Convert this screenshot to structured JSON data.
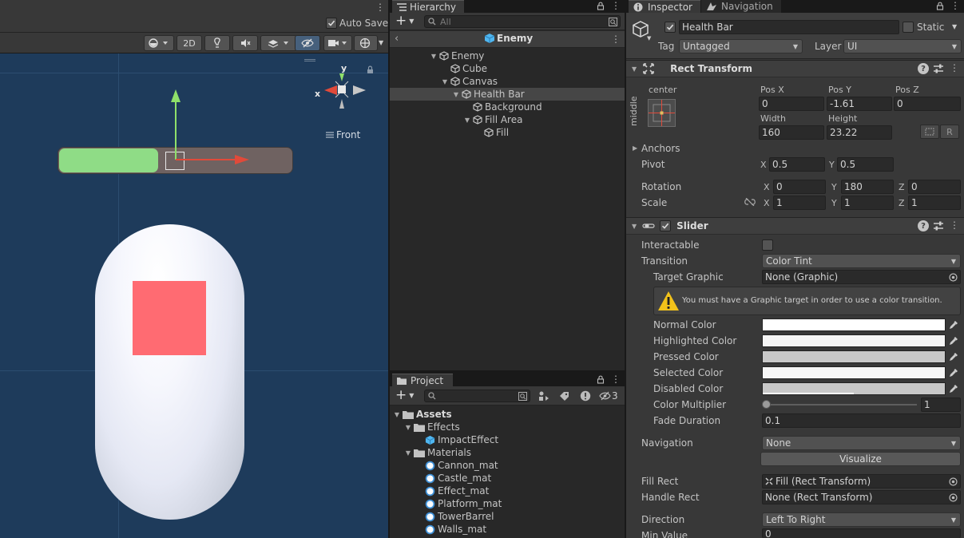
{
  "scene": {
    "auto_save_label": "Auto Save",
    "btn_2d": "2D",
    "gizmo_label": "Front",
    "axis_y": "y",
    "axis_x": "x",
    "colors": {
      "background": "#1e3b5b",
      "fill": "#8fdc86",
      "track": "#6f6261",
      "square": "#ff6b72",
      "capsule": "#f0f2fa"
    }
  },
  "hierarchy": {
    "tab_label": "Hierarchy",
    "search_placeholder": "All",
    "scene_name": "Enemy",
    "items": [
      {
        "label": "Enemy",
        "depth": 0,
        "expanded": true
      },
      {
        "label": "Cube",
        "depth": 1,
        "expanded": false
      },
      {
        "label": "Canvas",
        "depth": 1,
        "expanded": true
      },
      {
        "label": "Health Bar",
        "depth": 2,
        "expanded": true,
        "selected": true
      },
      {
        "label": "Background",
        "depth": 3,
        "expanded": false
      },
      {
        "label": "Fill Area",
        "depth": 3,
        "expanded": true
      },
      {
        "label": "Fill",
        "depth": 4,
        "expanded": false
      }
    ]
  },
  "project": {
    "tab_label": "Project",
    "hidden_count": "3",
    "items": [
      {
        "label": "Assets",
        "depth": 0,
        "type": "folder",
        "bold": true
      },
      {
        "label": "Effects",
        "depth": 1,
        "type": "folder"
      },
      {
        "label": "ImpactEffect",
        "depth": 2,
        "type": "prefab"
      },
      {
        "label": "Materials",
        "depth": 1,
        "type": "folder"
      },
      {
        "label": "Cannon_mat",
        "depth": 2,
        "type": "material"
      },
      {
        "label": "Castle_mat",
        "depth": 2,
        "type": "material"
      },
      {
        "label": "Effect_mat",
        "depth": 2,
        "type": "material"
      },
      {
        "label": "Platform_mat",
        "depth": 2,
        "type": "material"
      },
      {
        "label": "TowerBarrel",
        "depth": 2,
        "type": "material"
      },
      {
        "label": "Walls_mat",
        "depth": 2,
        "type": "material"
      }
    ]
  },
  "inspector": {
    "tab_inspector": "Inspector",
    "tab_navigation": "Navigation",
    "object_name": "Health Bar",
    "static_label": "Static",
    "tag_label": "Tag",
    "tag_value": "Untagged",
    "layer_label": "Layer",
    "layer_value": "UI",
    "rect_transform": {
      "title": "Rect Transform",
      "anchor_h": "center",
      "anchor_v": "middle",
      "pos_x_label": "Pos X",
      "pos_x": "0",
      "pos_y_label": "Pos Y",
      "pos_y": "-1.61",
      "pos_z_label": "Pos Z",
      "pos_z": "0",
      "width_label": "Width",
      "width": "160",
      "height_label": "Height",
      "height": "23.22",
      "r_btn": "R",
      "anchors_label": "Anchors",
      "pivot_label": "Pivot",
      "pivot_x": "0.5",
      "pivot_y": "0.5",
      "rotation_label": "Rotation",
      "rot_x": "0",
      "rot_y": "180",
      "rot_z": "0",
      "scale_label": "Scale",
      "scale_x": "1",
      "scale_y": "1",
      "scale_z": "1",
      "axis_x": "X",
      "axis_y": "Y",
      "axis_z": "Z"
    },
    "slider": {
      "title": "Slider",
      "interactable_label": "Interactable",
      "transition_label": "Transition",
      "transition_value": "Color Tint",
      "target_graphic_label": "Target Graphic",
      "target_graphic_value": "None (Graphic)",
      "warning": "You must have a Graphic target in order to use a color transition.",
      "normal_color_label": "Normal Color",
      "highlighted_color_label": "Highlighted Color",
      "pressed_color_label": "Pressed Color",
      "selected_color_label": "Selected Color",
      "disabled_color_label": "Disabled Color",
      "color_multiplier_label": "Color Multiplier",
      "color_multiplier": "1",
      "fade_duration_label": "Fade Duration",
      "fade_duration": "0.1",
      "navigation_label": "Navigation",
      "navigation_value": "None",
      "visualize_btn": "Visualize",
      "fill_rect_label": "Fill Rect",
      "fill_rect_value": "Fill (Rect Transform)",
      "handle_rect_label": "Handle Rect",
      "handle_rect_value": "None (Rect Transform)",
      "direction_label": "Direction",
      "direction_value": "Left To Right",
      "min_value_label": "Min Value",
      "min_value": "0",
      "colors": {
        "normal": "#ffffff",
        "highlighted": "#f5f5f5",
        "pressed": "#c8c8c8",
        "selected": "#f5f5f5",
        "disabled": "#c8c8c8"
      }
    }
  }
}
